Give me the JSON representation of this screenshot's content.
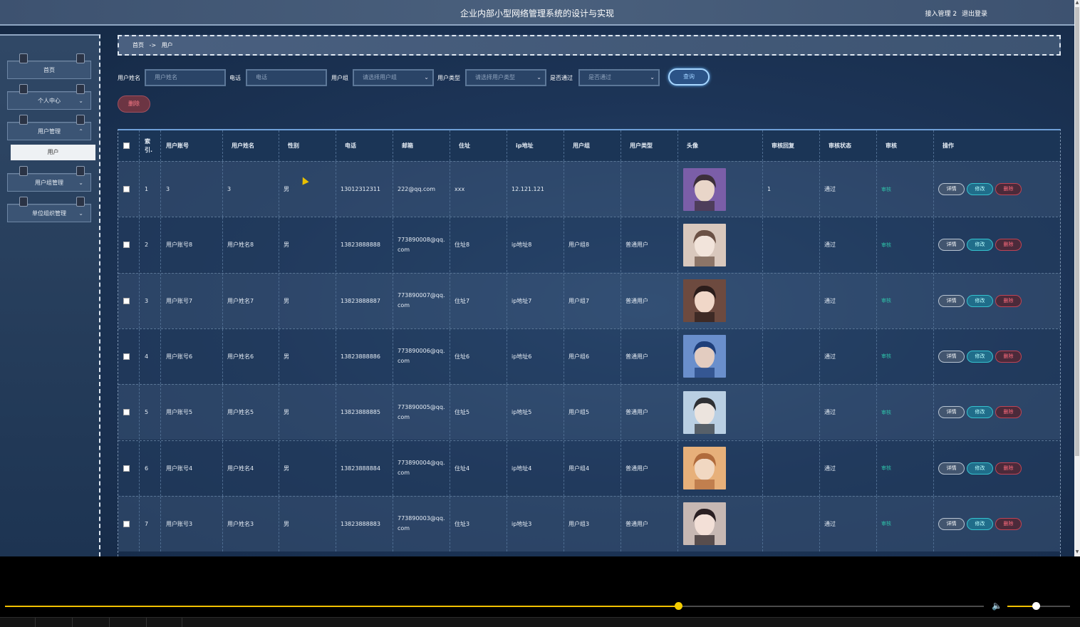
{
  "header": {
    "title": "企业内部小型网络管理系统的设计与实现",
    "user_label": "接入管理 2",
    "logout": "退出登录"
  },
  "sidebar": {
    "items": [
      {
        "label": "首页",
        "has_chevron": false,
        "chevron": ""
      },
      {
        "label": "个人中心",
        "has_chevron": true,
        "chevron": "⌄"
      },
      {
        "label": "用户管理",
        "has_chevron": true,
        "chevron": "⌃"
      },
      {
        "label": "用户组管理",
        "has_chevron": true,
        "chevron": "⌄"
      },
      {
        "label": "单位组织管理",
        "has_chevron": true,
        "chevron": "⌄"
      }
    ],
    "active_sub": "用户"
  },
  "breadcrumb": {
    "home": "首页",
    "sep": "->",
    "current": "用户"
  },
  "search": {
    "name_label": "用户姓名",
    "name_placeholder": "用户姓名",
    "phone_label": "电话",
    "phone_placeholder": "电话",
    "group_label": "用户组",
    "group_value": "请选择用户组",
    "type_label": "用户类型",
    "type_value": "请选择用户类型",
    "pass_label": "是否通过",
    "pass_value": "是否通过",
    "query": "查询"
  },
  "delete_button": "删除",
  "table": {
    "headers": [
      "",
      "索引",
      "用户账号",
      "用户姓名",
      "性别",
      "电话",
      "邮箱",
      "住址",
      "ip地址",
      "用户组",
      "用户类型",
      "头像",
      "审核回复",
      "审核状态",
      "审核",
      "操作"
    ],
    "index_header_top": "索",
    "index_header_bottom": "引.",
    "rows": [
      {
        "idx": "1",
        "account": "3",
        "name": "3",
        "gender": "男",
        "phone": "13012312311",
        "email": "222@qq.com",
        "address": "xxx",
        "ip": "12.121.121",
        "group": "",
        "type": "",
        "reply": "1",
        "status": "通过",
        "audit": "审核"
      },
      {
        "idx": "2",
        "account": "用户账号8",
        "name": "用户姓名8",
        "gender": "男",
        "phone": "13823888888",
        "email": "773890008@qq.com",
        "address": "住址8",
        "ip": "ip地址8",
        "group": "用户组8",
        "type": "普通用户",
        "reply": "",
        "status": "通过",
        "audit": "审核"
      },
      {
        "idx": "3",
        "account": "用户账号7",
        "name": "用户姓名7",
        "gender": "男",
        "phone": "13823888887",
        "email": "773890007@qq.com",
        "address": "住址7",
        "ip": "ip地址7",
        "group": "用户组7",
        "type": "普通用户",
        "reply": "",
        "status": "通过",
        "audit": "审核"
      },
      {
        "idx": "4",
        "account": "用户账号6",
        "name": "用户姓名6",
        "gender": "男",
        "phone": "13823888886",
        "email": "773890006@qq.com",
        "address": "住址6",
        "ip": "ip地址6",
        "group": "用户组6",
        "type": "普通用户",
        "reply": "",
        "status": "通过",
        "audit": "审核"
      },
      {
        "idx": "5",
        "account": "用户账号5",
        "name": "用户姓名5",
        "gender": "男",
        "phone": "13823888885",
        "email": "773890005@qq.com",
        "address": "住址5",
        "ip": "ip地址5",
        "group": "用户组5",
        "type": "普通用户",
        "reply": "",
        "status": "通过",
        "audit": "审核"
      },
      {
        "idx": "6",
        "account": "用户账号4",
        "name": "用户姓名4",
        "gender": "男",
        "phone": "13823888884",
        "email": "773890004@qq.com",
        "address": "住址4",
        "ip": "ip地址4",
        "group": "用户组4",
        "type": "普通用户",
        "reply": "",
        "status": "通过",
        "audit": "审核"
      },
      {
        "idx": "7",
        "account": "用户账号3",
        "name": "用户姓名3",
        "gender": "男",
        "phone": "13823888883",
        "email": "773890003@qq.com",
        "address": "住址3",
        "ip": "ip地址3",
        "group": "用户组3",
        "type": "普通用户",
        "reply": "",
        "status": "通过",
        "audit": "审核"
      }
    ],
    "actions": {
      "detail": "详情",
      "edit": "修改",
      "delete": "删除"
    }
  },
  "player": {
    "progress": 0.688,
    "volume": 0.45
  }
}
